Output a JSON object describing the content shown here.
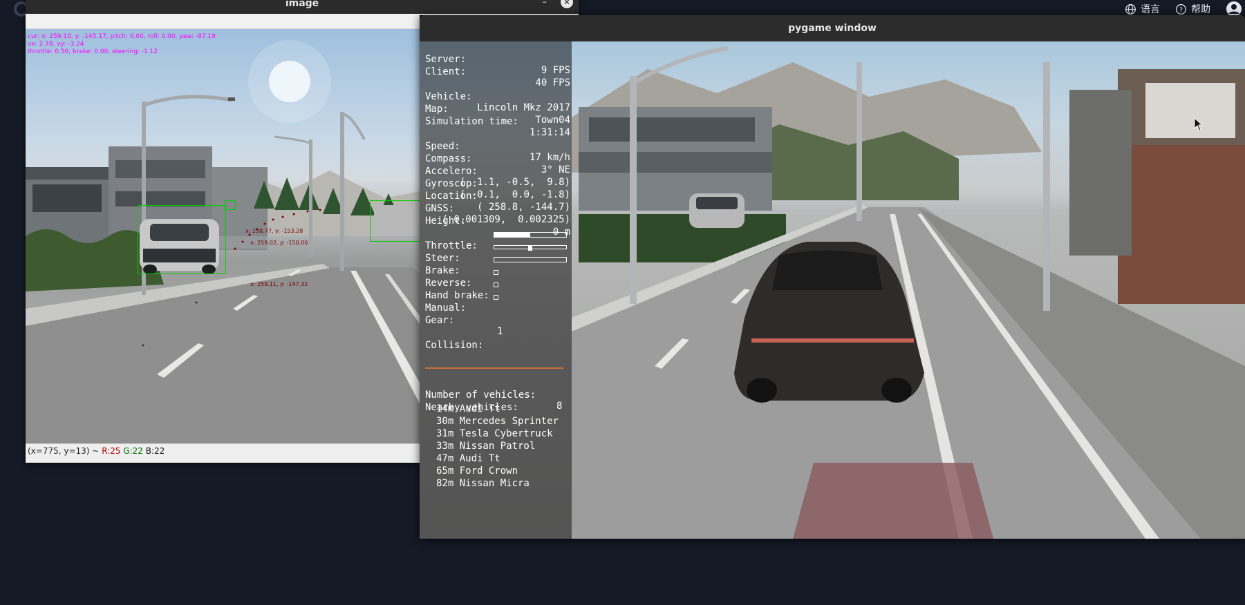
{
  "system_bar": {
    "language_label": "语言",
    "help_label": "帮助",
    "language_icon": "globe-icon",
    "help_icon": "question-circle-icon",
    "user_icon": "user-avatar-icon"
  },
  "cv_window": {
    "title": "image",
    "hud_lines": [
      "cur: x: 259.10, y: -145.17, pitch: 0.00, roll: 0.00, yaw: -87.19",
      "vx: 2.78, vy: -3.24",
      "throttle: 0.50, brake: 0.00, steering: -1.12"
    ],
    "detections": [
      {
        "label": "x: 258.77, y: -153.28"
      },
      {
        "label": "x: 259.02, y: -150.00"
      },
      {
        "label": "x: 259.11, y: -147.32"
      }
    ],
    "status": {
      "coords": "(x=775, y=13) ~",
      "r": "R:25",
      "g": "G:22",
      "b": "B:22"
    }
  },
  "pygame_window": {
    "title": "pygame window",
    "hud": {
      "server_label": "Server:",
      "server_value": "9 FPS",
      "client_label": "Client:",
      "client_value": "40 FPS",
      "vehicle_label": "Vehicle:",
      "vehicle_value": "Lincoln Mkz 2017",
      "map_label": "Map:",
      "map_value": "Town04",
      "simtime_label": "Simulation time:",
      "simtime_value": "1:31:14",
      "speed_label": "Speed:",
      "speed_value": "17 km/h",
      "compass_label": "Compass:",
      "compass_value": "3° NE",
      "accel_label": "Accelero:",
      "accel_value": "(  1.1, -0.5,  9.8)",
      "gyro_label": "Gyroscop:",
      "gyro_value": "( -0.1,  0.0, -1.8)",
      "location_label": "Location:",
      "location_value": "( 258.8, -144.7)",
      "gnss_label": "GNSS:",
      "gnss_value": "( 0.001309,  0.002325)",
      "height_label": "Height:",
      "height_value": "0 m",
      "throttle_label": "Throttle:",
      "throttle_fraction": 0.5,
      "steer_label": "Steer:",
      "steer_value": 0.0,
      "brake_label": "Brake:",
      "brake_fraction": 0.0,
      "reverse_label": "Reverse:",
      "handbrake_label": "Hand brake:",
      "manual_label": "Manual:",
      "gear_label": "Gear:",
      "gear_value": "1",
      "collision_label": "Collision:",
      "num_vehicles_label": "Number of vehicles:",
      "num_vehicles_value": "8",
      "nearby_label": "Nearby vehicles:",
      "nearby": [
        "14m Audi Tt",
        "30m Mercedes Sprinter",
        "31m Tesla Cybertruck",
        "33m Nissan Patrol",
        "47m Audi Tt",
        "65m Ford Crown",
        "82m Nissan Micra"
      ]
    }
  },
  "colors": {
    "desktop": "#141a26",
    "hud_magenta": "#ff00ff",
    "bbox_green": "#00d000",
    "detection_red": "#7a0000",
    "separator_orange": "#c8703a"
  }
}
